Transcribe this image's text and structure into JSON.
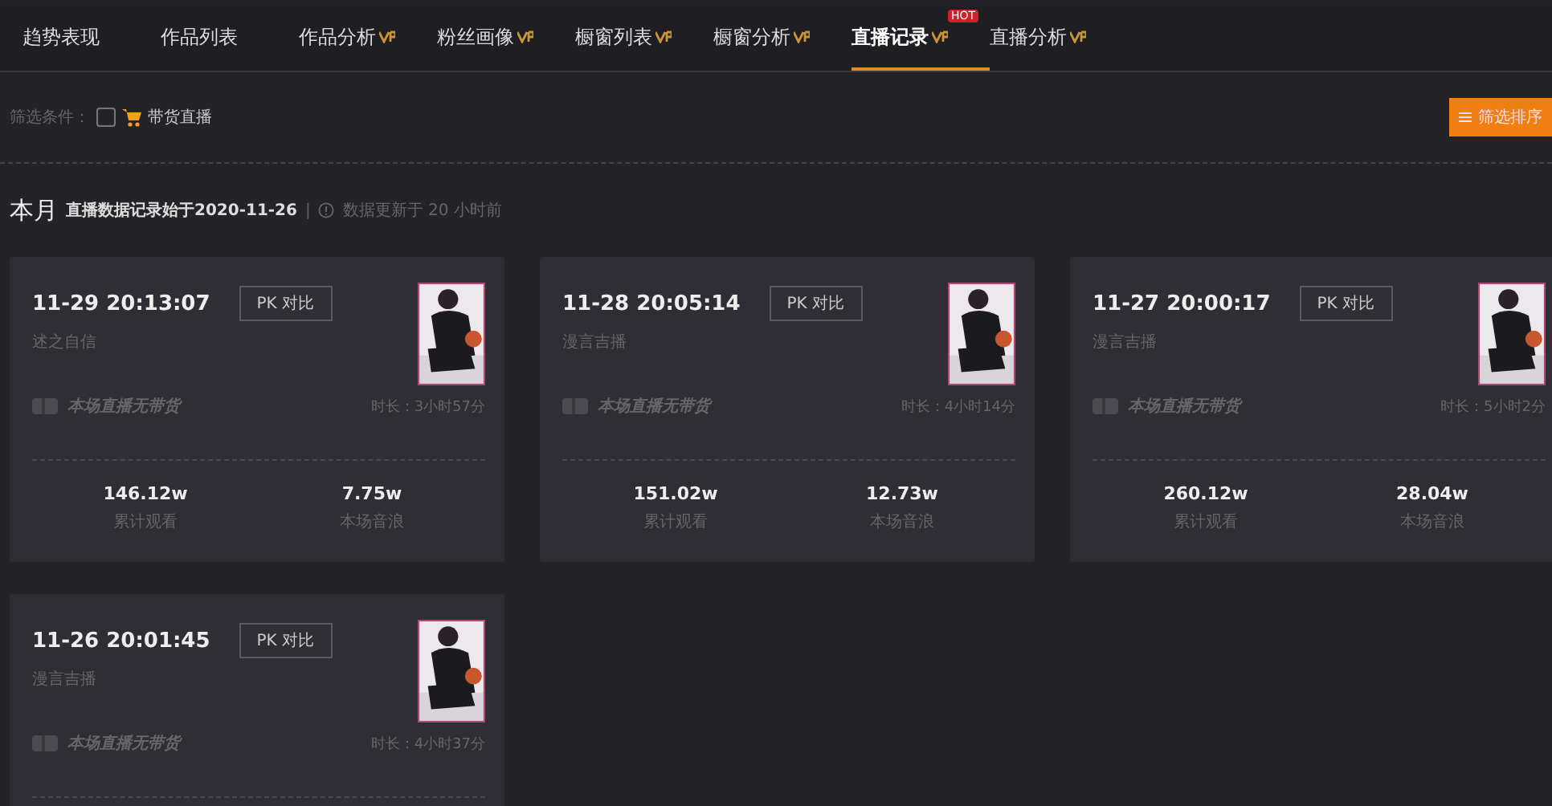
{
  "tabs": [
    {
      "label": "趋势表现",
      "selected": false,
      "vip": false
    },
    {
      "label": "作品列表",
      "selected": false,
      "vip": false
    },
    {
      "label": "作品分析",
      "selected": false,
      "vip": true
    },
    {
      "label": "粉丝画像",
      "selected": false,
      "vip": true
    },
    {
      "label": "橱窗列表",
      "selected": false,
      "vip": true
    },
    {
      "label": "橱窗分析",
      "selected": false,
      "vip": true
    },
    {
      "label": "直播记录",
      "selected": true,
      "vip": true,
      "badge": "HOT"
    },
    {
      "label": "直播分析",
      "selected": false,
      "vip": true
    }
  ],
  "filter": {
    "label": "筛选条件：",
    "option": {
      "label": "带货直播",
      "checked": false
    },
    "sort_button": "筛选排序"
  },
  "period": {
    "title": "本月",
    "note": "直播数据记录始于2020-11-26",
    "divider": "|",
    "updated": "数据更新于 20 小时前"
  },
  "cards": [
    {
      "time": "11-29 20:13:07",
      "pk_button": "PK 对比",
      "subtitle": "述之自信",
      "goods": "本场直播无带货",
      "duration": "时长：3小时57分",
      "stats": [
        {
          "value": "146.12w",
          "label": "累计观看"
        },
        {
          "value": "7.75w",
          "label": "本场音浪"
        }
      ]
    },
    {
      "time": "11-28 20:05:14",
      "pk_button": "PK 对比",
      "subtitle": "漫言吉播",
      "goods": "本场直播无带货",
      "duration": "时长：4小时14分",
      "stats": [
        {
          "value": "151.02w",
          "label": "累计观看"
        },
        {
          "value": "12.73w",
          "label": "本场音浪"
        }
      ]
    },
    {
      "time": "11-27 20:00:17",
      "pk_button": "PK 对比",
      "subtitle": "漫言吉播",
      "goods": "本场直播无带货",
      "duration": "时长：5小时2分",
      "stats": [
        {
          "value": "260.12w",
          "label": "累计观看"
        },
        {
          "value": "28.04w",
          "label": "本场音浪"
        }
      ]
    },
    {
      "time": "11-26 20:01:45",
      "pk_button": "PK 对比",
      "subtitle": "漫言吉播",
      "goods": "本场直播无带货",
      "duration": "时长：4小时37分"
    }
  ]
}
